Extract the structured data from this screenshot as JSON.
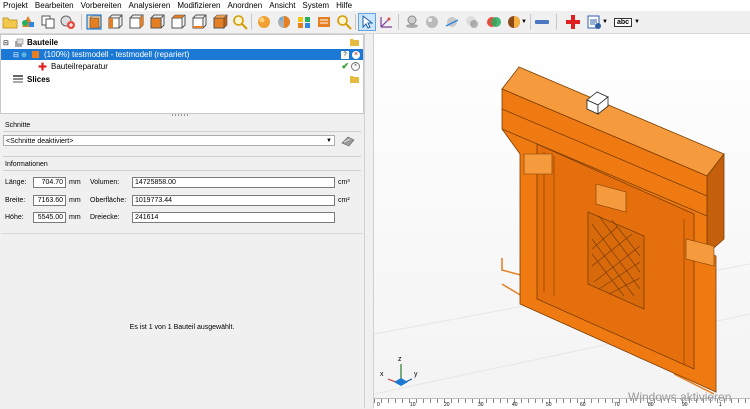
{
  "menu": [
    "Projekt",
    "Bearbeiten",
    "Vorbereiten",
    "Analysieren",
    "Modifizieren",
    "Anordnen",
    "Ansicht",
    "System",
    "Hilfe"
  ],
  "toolbar": {
    "text_tool_label": "abc",
    "icons": [
      "open-file-icon",
      "add-part-icon",
      "copy-icon",
      "add-copy-icon",
      "view-front-icon",
      "view-back-icon",
      "view-left-icon",
      "view-right-icon",
      "view-top-icon",
      "view-bottom-icon",
      "view-iso-icon",
      "zoom-icon",
      "shade-icon",
      "render-icon",
      "select-icon",
      "measure-icon",
      "plane-icon",
      "sphere-icon",
      "cut-icon",
      "color-icon",
      "light-icon",
      "minus-icon",
      "repair-icon",
      "report-icon",
      "text-icon"
    ]
  },
  "tree": {
    "parts_label": "Bauteile",
    "model_label": "(100%) testmodell - testmodell (repariert)",
    "repair_label": "Bauteilreparatur",
    "slices_label": "Slices"
  },
  "sections": {
    "title": "Schnitte",
    "selected": "<Schnitte deaktiviert>"
  },
  "info": {
    "title": "Informationen",
    "length_label": "Länge:",
    "length_value": "704.70",
    "width_label": "Breite:",
    "width_value": "7163.60",
    "height_label": "Höhe:",
    "height_value": "5545.00",
    "unit_mm": "mm",
    "volume_label": "Volumen:",
    "volume_value": "14725858.00",
    "volume_unit": "cm³",
    "surface_label": "Oberfläche:",
    "surface_value": "1019773.44",
    "surface_unit": "cm²",
    "triangles_label": "Dreiecke:",
    "triangles_value": "241614"
  },
  "status": {
    "text": "Es ist 1 von 1 Bauteil ausgewählt."
  },
  "viewport": {
    "model_color": "#f07a12",
    "axis_labels": {
      "x": "x",
      "y": "y",
      "z": "z"
    },
    "watermark": "Windows aktivieren",
    "ruler_labels": [
      "0",
      "10",
      "20",
      "30",
      "40",
      "50",
      "60",
      "70",
      "80",
      "90",
      "1"
    ]
  }
}
